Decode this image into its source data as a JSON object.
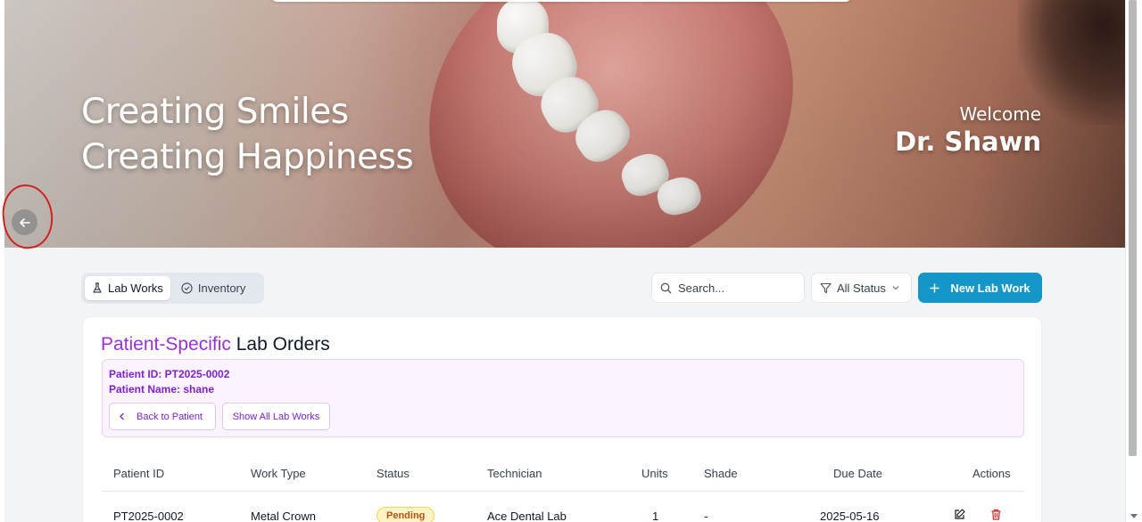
{
  "hero": {
    "line1": "Creating Smiles",
    "line2": "Creating Happiness",
    "welcome": "Welcome",
    "doctor": "Dr. Shawn"
  },
  "tabs": [
    {
      "label": "Lab Works",
      "icon": "flask-icon",
      "active": true
    },
    {
      "label": "Inventory",
      "icon": "check-circle-icon",
      "active": false
    }
  ],
  "search": {
    "placeholder": "Search...",
    "value": ""
  },
  "filter": {
    "selected": "All Status"
  },
  "new_button": {
    "label": "New Lab Work"
  },
  "card": {
    "title_accent": "Patient-Specific",
    "title_rest": " Lab Orders",
    "patient_id": "Patient ID: PT2025-0002",
    "patient_name": "Patient Name: shane",
    "back_label": "Back to Patient",
    "show_all_label": "Show All Lab Works"
  },
  "table": {
    "headers": [
      "Patient ID",
      "Work Type",
      "Status",
      "Technician",
      "Units",
      "Shade",
      "Due Date",
      "Actions"
    ],
    "rows": [
      {
        "patient_id": "PT2025-0002",
        "work_type": "Metal Crown",
        "status": "Pending",
        "technician": "Ace Dental Lab",
        "units": "1",
        "shade": "-",
        "due_date": "2025-05-16"
      }
    ]
  },
  "colors": {
    "accent": "#9b30d9",
    "primary": "#1596c8",
    "pending": "#b45309",
    "danger": "#dc2626"
  }
}
